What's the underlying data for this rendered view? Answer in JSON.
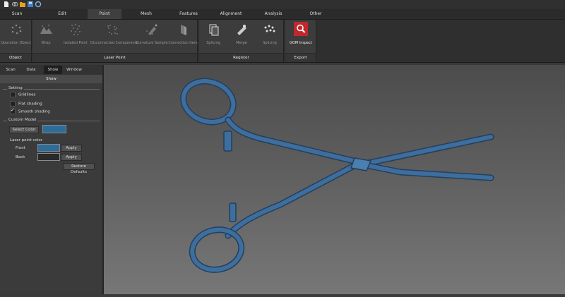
{
  "menu": {
    "items": [
      {
        "label": "Scan"
      },
      {
        "label": "Edit"
      },
      {
        "label": "Point"
      },
      {
        "label": "Mesh"
      },
      {
        "label": "Features"
      },
      {
        "label": "Alignment"
      },
      {
        "label": "Analysis"
      },
      {
        "label": "Other"
      }
    ],
    "active_index": 2
  },
  "ribbon": {
    "groups": [
      {
        "label": "Object",
        "tools": [
          {
            "label": "Operation Object",
            "icon": "operation-object-icon"
          }
        ]
      },
      {
        "label": "Laser Point",
        "tools": [
          {
            "label": "Wrap",
            "icon": "wrap-icon"
          },
          {
            "label": "Isolated Point",
            "icon": "isolated-point-icon"
          },
          {
            "label": "Disconnected Components",
            "icon": "disconnected-components-icon"
          },
          {
            "label": "Curvature Sample",
            "icon": "curvature-sample-icon"
          },
          {
            "label": "Connection Item",
            "icon": "connection-item-icon"
          }
        ]
      },
      {
        "label": "Register",
        "tools": [
          {
            "label": "Splicing",
            "icon": "splicing-icon"
          },
          {
            "label": "Merge",
            "icon": "merge-icon"
          },
          {
            "label": "Splicing",
            "icon": "point-splicing-icon"
          }
        ]
      },
      {
        "label": "Export",
        "tools": [
          {
            "label": "GOM Inspect",
            "icon": "gom-inspect-icon"
          }
        ]
      }
    ]
  },
  "panel": {
    "tabs": [
      {
        "label": "Scan"
      },
      {
        "label": "Data"
      },
      {
        "label": "Show"
      },
      {
        "label": "Window"
      }
    ],
    "active_tab": 2,
    "section_title": "Show",
    "setting": {
      "title": "Setting",
      "gridlines": {
        "label": "Gridlines",
        "checked": false
      },
      "flat_shading": {
        "label": "Flat shading",
        "checked": false
      },
      "smooth_shading": {
        "label": "Smooth shading",
        "checked": true
      }
    },
    "custom_model": {
      "title": "Custom Model",
      "select_color_label": "Select Color",
      "model_color": "#2e6c9a"
    },
    "laser_point_color": {
      "title": "Laser point color",
      "front": {
        "label": "Front",
        "color": "#2e6c9a",
        "apply_label": "Apply"
      },
      "back": {
        "label": "Back",
        "color": "#2a2a2a",
        "apply_label": "Apply"
      },
      "restore_label": "Restore Defaults"
    }
  },
  "colors": {
    "accent_blue": "#2e6c9a",
    "gom_red": "#c0282d",
    "model_blue": "#3d6e9e"
  },
  "titlebar": {
    "icons": [
      "new-file-icon",
      "link-icon",
      "open-folder-icon",
      "save-icon",
      "settings-icon"
    ]
  }
}
